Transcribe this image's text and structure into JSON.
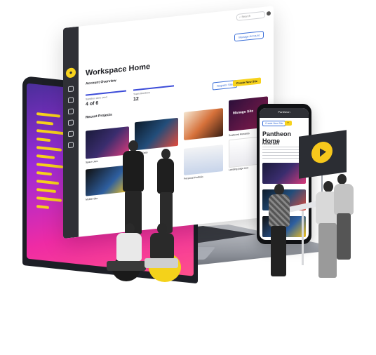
{
  "browser": {
    "search_placeholder": "Search",
    "manage_button": "Manage Account",
    "title": "Workspace Home",
    "account_overview": "Account Overview",
    "stats": [
      {
        "label": "Sandbox sites used",
        "value": "4 of 6"
      },
      {
        "label": "Team Members",
        "value": "12"
      }
    ],
    "outline_button": "Register Site",
    "upgrade_button": "Create New Site",
    "recent_projects_title": "Recent Projects",
    "thumbnails": [
      {
        "label": "Space Jam"
      },
      {
        "label": "Space Daily"
      },
      {
        "label": "Mobile Site"
      },
      {
        "label": "Personal Portfolio"
      },
      {
        "label": "Landing page test"
      }
    ],
    "card_title": "Manage Site",
    "card_label": "Scattered Rewards"
  },
  "phone": {
    "brand": "Pantheon",
    "chip_outline": "Create New Site",
    "title": "Pantheon Home",
    "section": "Recent Sites"
  },
  "colors": {
    "accent_yellow": "#f7d21c",
    "accent_blue": "#3b6fd8",
    "nav_dark": "#2f3036",
    "screen_magenta": "#ef2ba4",
    "screen_purple": "#4a2f9a"
  },
  "icons": [
    "play-icon",
    "search-icon",
    "avatar-icon",
    "logo-icon"
  ]
}
